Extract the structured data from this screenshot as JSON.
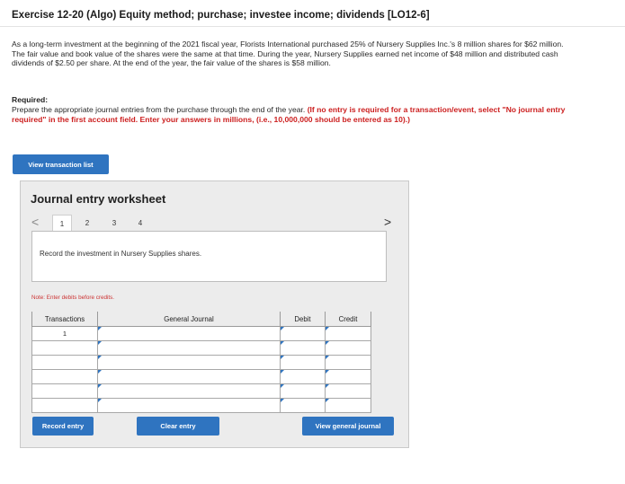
{
  "header": {
    "title": "Exercise 12-20 (Algo) Equity method; purchase; investee income; dividends [LO12-6]"
  },
  "problem": {
    "text": "As a long-term investment at the beginning of the 2021 fiscal year, Florists International purchased 25% of Nursery Supplies Inc.'s 8 million shares for $62 million. The fair value and book value of the shares were the same at that time. During the year, Nursery Supplies earned net income of $48 million and distributed cash dividends of $2.50 per share. At the end of the year, the fair value of the shares is $58 million."
  },
  "required": {
    "heading": "Required:",
    "text": "Prepare the appropriate journal entries from the purchase through the end of the year.",
    "instruction": "(If no entry is required for a transaction/event, select \"No journal entry required\" in the first account field. Enter your answers in millions, (i.e., 10,000,000 should be entered as 10).)"
  },
  "buttons": {
    "view_transaction_list": "View transaction list",
    "record_entry": "Record entry",
    "clear_entry": "Clear entry",
    "view_general_journal": "View general journal"
  },
  "worksheet": {
    "title": "Journal entry worksheet",
    "nav_prev": "<",
    "nav_next": ">",
    "tabs": [
      "1",
      "2",
      "3",
      "4"
    ],
    "active_tab": "1",
    "description": "Record the investment in Nursery Supplies shares.",
    "note": "Note: Enter debits before credits."
  },
  "journal_table": {
    "headers": {
      "transactions": "Transactions",
      "general_journal": "General Journal",
      "debit": "Debit",
      "credit": "Credit"
    },
    "rows": [
      {
        "transaction": "1",
        "account": "",
        "debit": "",
        "credit": ""
      },
      {
        "transaction": "",
        "account": "",
        "debit": "",
        "credit": ""
      },
      {
        "transaction": "",
        "account": "",
        "debit": "",
        "credit": ""
      },
      {
        "transaction": "",
        "account": "",
        "debit": "",
        "credit": ""
      },
      {
        "transaction": "",
        "account": "",
        "debit": "",
        "credit": ""
      },
      {
        "transaction": "",
        "account": "",
        "debit": "",
        "credit": ""
      }
    ]
  },
  "colors": {
    "accent_blue": "#2f74c0",
    "instruction_red": "#cc1f1f",
    "panel_gray": "#ececec"
  }
}
